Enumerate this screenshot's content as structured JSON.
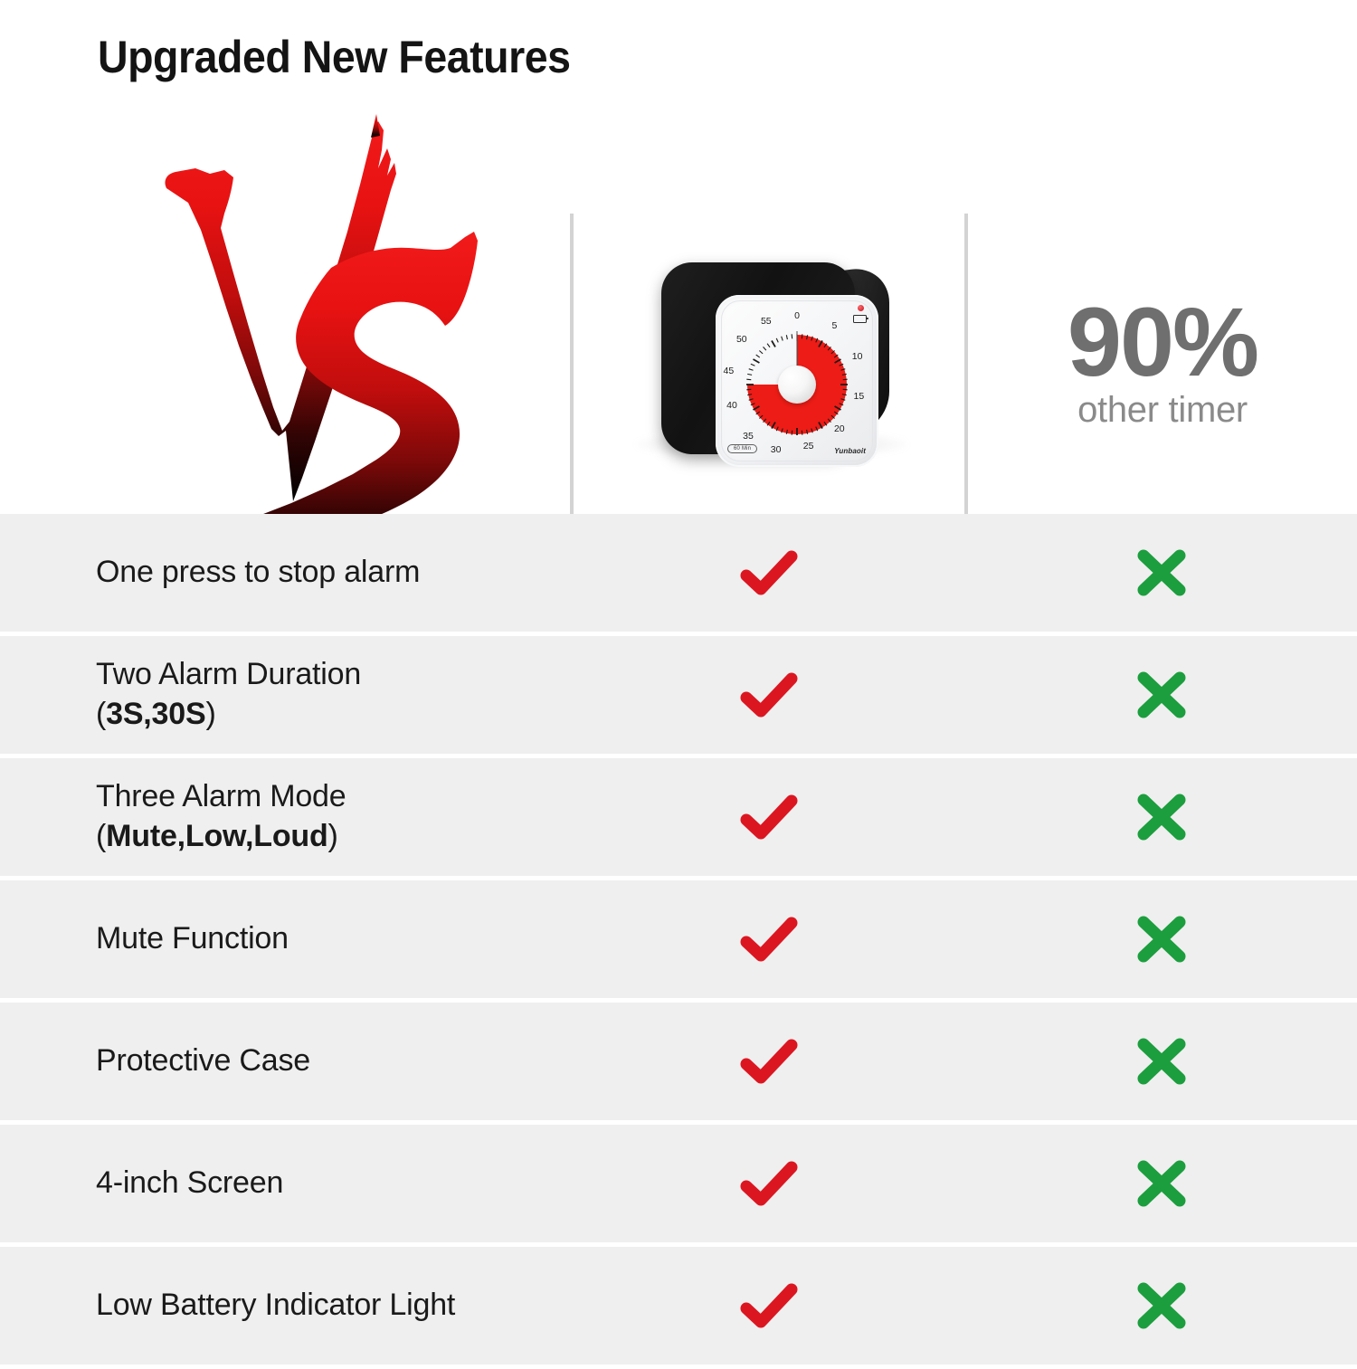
{
  "header": {
    "title": "Upgraded New Features",
    "vs_badge_label": "VS"
  },
  "columns": {
    "product_column_label": "Yunbaoit timer",
    "other_column": {
      "percent": "90%",
      "caption": "other timer"
    }
  },
  "product": {
    "brand": "Yunbaoit",
    "badge": "60 Min",
    "dial_numbers": [
      "0",
      "5",
      "10",
      "15",
      "20",
      "25",
      "30",
      "35",
      "40",
      "45",
      "50",
      "55"
    ],
    "dial_red_color": "#ED1C16",
    "case_color": "#121212",
    "led_color": "#C41020"
  },
  "marks": {
    "check_color": "#DC1621",
    "cross_color": "#1C9E3E",
    "check_name": "check-mark",
    "cross_name": "cross-mark"
  },
  "features": [
    {
      "label": "One press to stop alarm",
      "ours": "check",
      "theirs": "cross"
    },
    {
      "label": "Two Alarm Duration\n(3S,30S)",
      "ours": "check",
      "theirs": "cross"
    },
    {
      "label": "Three Alarm Mode\n(Mute,Low,Loud)",
      "ours": "check",
      "theirs": "cross"
    },
    {
      "label": "Mute Function",
      "ours": "check",
      "theirs": "cross"
    },
    {
      "label": "Protective Case",
      "ours": "check",
      "theirs": "cross"
    },
    {
      "label": "4-inch Screen",
      "ours": "check",
      "theirs": "cross"
    },
    {
      "label": "Low Battery Indicator Light",
      "ours": "check",
      "theirs": "cross"
    }
  ],
  "theme": {
    "row_background": "#EFEFEF",
    "page_background": "#FFFFFF",
    "divider_color": "#D3D3D3",
    "title_color": "#141414",
    "percent_color": "#6F6F6F",
    "caption_color": "#8A8A8A"
  }
}
